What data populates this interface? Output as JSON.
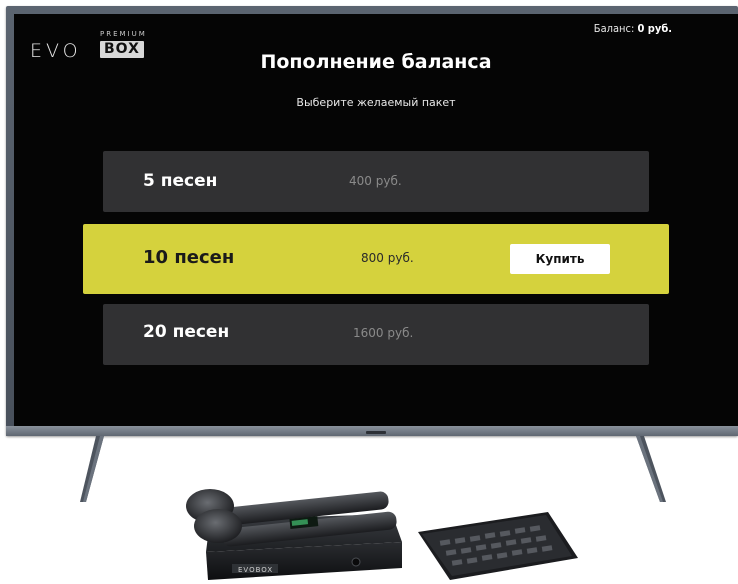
{
  "header": {
    "logo_premium": "PREMIUM",
    "logo_evo": "EVO",
    "logo_box": "BOX",
    "balance_label": "Баланс:",
    "balance_value": "0 руб."
  },
  "title": "Пополнение баланса",
  "subtitle": "Выберите желаемый пакет",
  "packages": [
    {
      "name": "5 песен",
      "price": "400 руб.",
      "selected": false
    },
    {
      "name": "10 песен",
      "price": "800 руб.",
      "selected": true,
      "buy_label": "Купить"
    },
    {
      "name": "20 песен",
      "price": "1600 руб.",
      "selected": false
    }
  ],
  "device_box_logo": "EVOBOX",
  "colors": {
    "screen_bg": "#050505",
    "package_bg": "#313133",
    "accent_yellow": "#d5d23d",
    "tv_frame": "#525a65"
  }
}
